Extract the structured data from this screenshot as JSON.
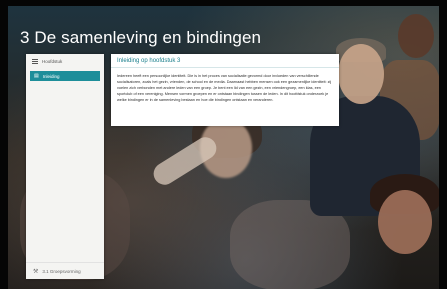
{
  "chapter_title": "3 De samenleving en bindingen",
  "sidebar": {
    "back_label": "Hoofdstuk",
    "items": [
      {
        "label": "Inleiding",
        "active": true,
        "icon": "document-icon"
      }
    ],
    "footer_label": "3.1  Groepsvorming",
    "footer_icon": "wrench-icon"
  },
  "content": {
    "title": "Inleiding op hoofdstuk 3",
    "body": "Iedereen heeft een persoonlijke identiteit. Die is in het proces van socialisatie gevormd door invloeden van verschillende socialisatoren, zoals het gezin, vrienden, de school en de media. Daarnaast hebben mensen ook een gezamenlijke identiteit: zij voelen zich verbonden met andere leden van een groep. Je bent een lid van een gezin, een vriendengroep, een klas, een sportclub of een vereniging. Mensen vormen groepen en er ontstaan bindingen tussen de leden. In dit hoofdstuk onderzoek je welke bindingen er in de samenleving bestaan en hoe die bindingen ontstaan en veranderen."
  },
  "colors": {
    "accent": "#1d8e9a",
    "title_text": "#ffffff"
  }
}
